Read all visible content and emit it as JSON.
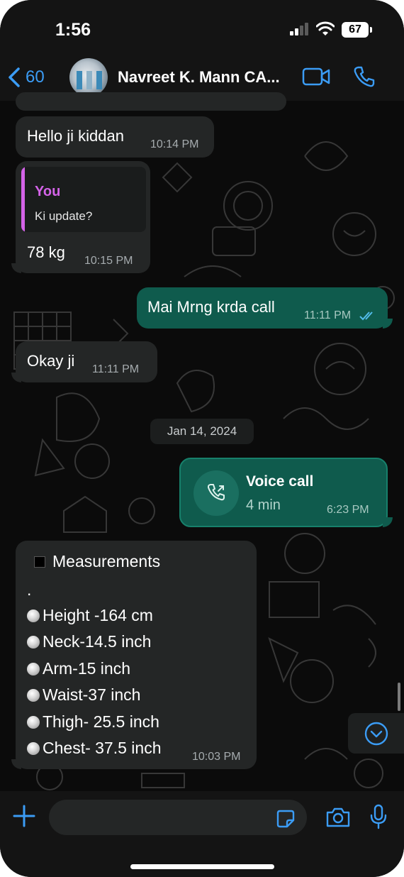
{
  "status_bar": {
    "time": "1:56",
    "battery": "67"
  },
  "header": {
    "back_count": "60",
    "contact_name": "Navreet K. Mann CA...",
    "icons": [
      "back-chevron-icon",
      "video-call-icon",
      "phone-icon"
    ]
  },
  "messages": [
    {
      "direction": "incoming",
      "text": "Hello ji kiddan",
      "time": "10:14 PM"
    },
    {
      "direction": "incoming",
      "reply_to": {
        "author": "You",
        "text": "Ki update?"
      },
      "text": "78 kg",
      "time": "10:15 PM"
    },
    {
      "direction": "outgoing",
      "text": "Mai Mrng krda call",
      "time": "11:11 PM",
      "status": "read"
    },
    {
      "direction": "incoming",
      "text": "Okay ji",
      "time": "11:11 PM"
    }
  ],
  "date_separator": "Jan 14, 2024",
  "voice_call": {
    "title": "Voice call",
    "duration": "4 min",
    "time": "6:23 PM"
  },
  "measurements": {
    "heading": "Measurements",
    "separator": ".",
    "items": [
      "Height -164 cm",
      "Neck-14.5 inch",
      "Arm-15 inch",
      "Waist-37 inch",
      "Thigh- 25.5 inch",
      "Chest- 37.5 inch"
    ],
    "time": "10:03 PM"
  },
  "composer": {
    "placeholder": ""
  },
  "colors": {
    "accent": "#3b9cf5",
    "incoming_bubble": "#242626",
    "outgoing_bubble": "#0f5b4d",
    "reply_author": "#d463e8"
  }
}
